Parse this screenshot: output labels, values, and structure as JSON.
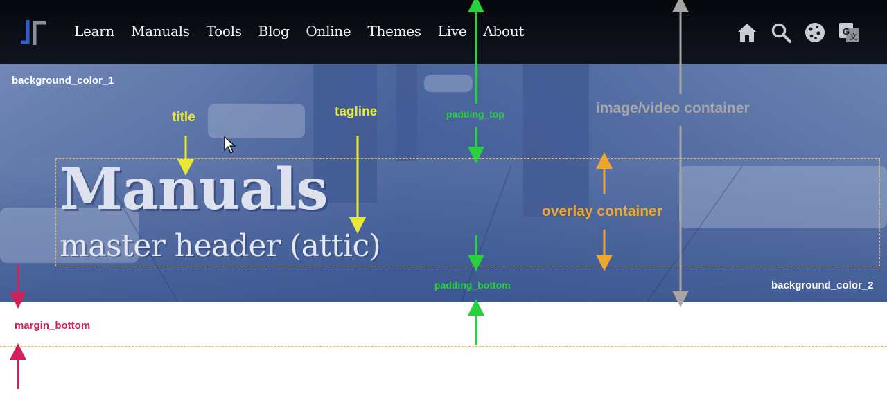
{
  "nav": {
    "links": [
      "Learn",
      "Manuals",
      "Tools",
      "Blog",
      "Online",
      "Themes",
      "Live",
      "About"
    ],
    "icons": [
      "home-icon",
      "search-icon",
      "cookie-icon",
      "translate-icon"
    ]
  },
  "hero": {
    "title": "Manuals",
    "tagline": "master header (attic)"
  },
  "annotations": {
    "background_color_1": "background_color_1",
    "background_color_2": "background_color_2",
    "title": "title",
    "tagline": "tagline",
    "padding_top": "padding_top",
    "padding_bottom": "padding_bottom",
    "image_container": "image/video container",
    "overlay_container": "overlay container",
    "margin_bottom": "margin_bottom"
  },
  "colors": {
    "nav_bg": "#0b0e15",
    "hero_tint": "#4a64a0",
    "title_arrow": "#e9e935",
    "padding_arrow": "#27d33c",
    "image_arrow": "#a6a6a6",
    "overlay_arrow": "#f0a62a",
    "margin_arrow": "#d4205a"
  }
}
